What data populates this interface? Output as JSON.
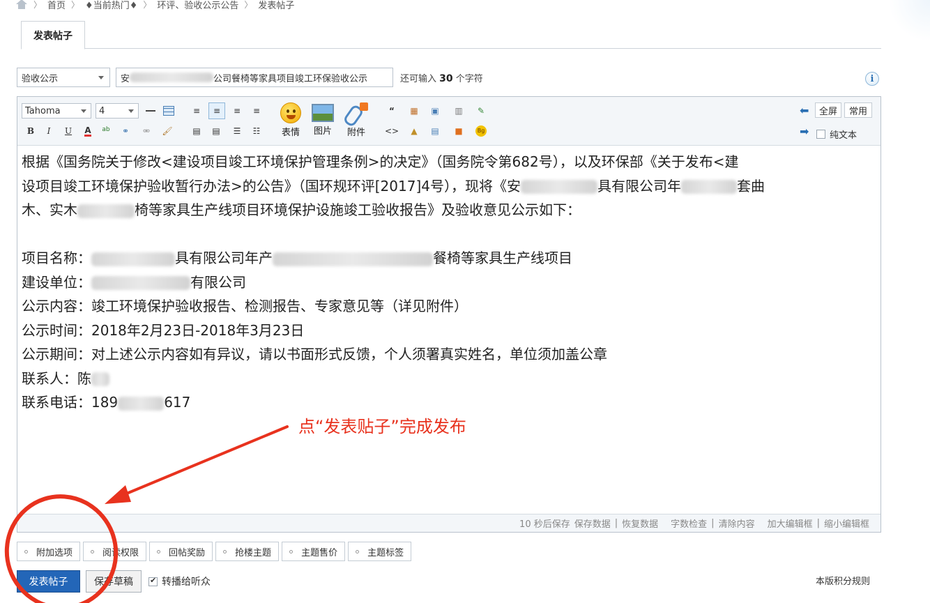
{
  "breadcrumb": {
    "items": [
      "首页",
      "♦当前热门♦",
      "环评、验收公示公告",
      "发表帖子"
    ]
  },
  "tabs": [
    {
      "label": "发表帖子",
      "active": true
    }
  ],
  "post": {
    "category": "验收公示",
    "title_prefix": "安",
    "title_suffix": "公司餐椅等家具项目竣工环保验收公示",
    "remaining_label_before": "还可输入",
    "remaining_count": "30",
    "remaining_label_after": "个字符"
  },
  "toolbar": {
    "font_family": "Tahoma",
    "font_size": "4",
    "emoji_label": "表情",
    "image_label": "图片",
    "attachment_label": "附件",
    "fullscreen_label": "全屏",
    "common_label": "常用",
    "plain_text_label": "纯文本"
  },
  "content": {
    "p1_l1": "根据《国务院关于修改<建设项目竣工环境保护管理条例>的决定》（国务院令第682号），以及环保部《关于发布<建",
    "p1_l2a": "设项目竣工环境保护验收暂行办法>的公告》（国环规环评[2017]4号），现将《安",
    "p1_l2b": "具有限公司年",
    "p1_l2c": "套曲",
    "p1_l3a": "木、实木",
    "p1_l3b": "椅等家具生产线项目环境保护设施竣工验收报告》及验收意见公示如下：",
    "project_label": "项目名称：",
    "project_a": "具有限公司年产",
    "project_b": "餐椅等家具生产线项目",
    "unit_label": "建设单位：",
    "unit_value": "有限公司",
    "scope_label": "公示内容：",
    "scope_value": "竣工环境保护验收报告、检测报告、专家意见等（详见附件）",
    "time_label": "公示时间：",
    "time_value": "2018年2月23日-2018年3月23日",
    "period_label": "公示期间：",
    "period_value": "对上述公示内容如有异议，请以书面形式反馈，个人须署真实姓名，单位须加盖公章",
    "contact_label": "联系人：",
    "contact_value": "陈",
    "phone_label": "联系电话：",
    "phone_prefix": "189",
    "phone_suffix": "617"
  },
  "statusbar": {
    "autosave": "10 秒后保存",
    "save_data": "保存数据",
    "restore_data": "恢复数据",
    "word_check": "字数检查",
    "clear_content": "清除内容",
    "enlarge": "加大编辑框",
    "shrink": "缩小编辑框"
  },
  "options": [
    "附加选项",
    "阅读权限",
    "回帖奖励",
    "抢楼主题",
    "主题售价",
    "主题标签"
  ],
  "actions": {
    "publish": "发表帖子",
    "save_draft": "保存草稿",
    "forward_label": "转播给听众",
    "forward_checked": true,
    "rules_link": "本版积分规则"
  },
  "annotation": {
    "text": "点“发表贴子”完成发布",
    "color": "#e8321e"
  }
}
